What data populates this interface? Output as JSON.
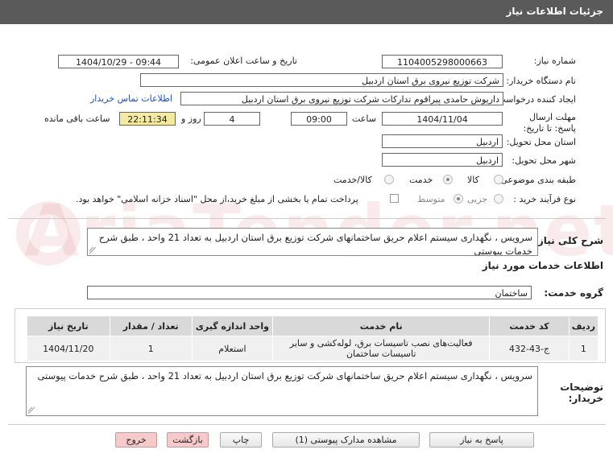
{
  "header": {
    "title": "جزئیات اطلاعات نیاز"
  },
  "form": {
    "need_number_label": "شماره نیاز:",
    "need_number": "1104005298000663",
    "announce_label": "تاریخ و ساعت اعلان عمومی:",
    "announce_value": "1404/10/29 - 09:44",
    "buyer_org_label": "نام دستگاه خریدار:",
    "buyer_org": "شرکت توزیع نیروی برق استان اردبیل",
    "requester_label": "ایجاد کننده درخواست:",
    "requester": "داریوش حامدی پیراقوم تدارکات شرکت توزیع نیروی برق استان اردبیل",
    "contact_link": "اطلاعات تماس خریدار",
    "deadline_label": "مهلت ارسال پاسخ: تا تاریخ:",
    "deadline_date": "1404/11/04",
    "time_label": "ساعت",
    "deadline_time": "09:00",
    "days_value": "4",
    "days_label": "روز و",
    "remaining_time": "22:11:34",
    "remaining_label": "ساعت باقی مانده",
    "province_label": "استان محل تحویل:",
    "province": "اردبیل",
    "city_label": "شهر محل تحویل:",
    "city": "اردبیل",
    "category_label": "طبقه بندی موضوعی:",
    "category_options": [
      "کالا",
      "خدمت",
      "کالا/خدمت"
    ],
    "category_selected": "خدمت",
    "purchase_type_label": "نوع فرآیند خرید :",
    "purchase_options": [
      "جزیی",
      "متوسط"
    ],
    "purchase_selected": "متوسط",
    "payment_note": "پرداخت تمام یا بخشی از مبلغ خرید،از محل \"اسناد خزانه اسلامی\" خواهد بود."
  },
  "summary": {
    "label": "شرح کلی نیاز:",
    "text": "سرویس ، نگهداری سیستم اعلام حریق ساختمانهای شرکت توزیع برق استان اردبیل به تعداد 21 واحد ، طبق شرح خدمات پیوستی"
  },
  "services": {
    "section_title": "اطلاعات خدمات مورد نیاز",
    "group_label": "گروه خدمت:",
    "group_value": "ساختمان",
    "columns": [
      "ردیف",
      "کد خدمت",
      "نام خدمت",
      "واحد اندازه گیری",
      "تعداد / مقدار",
      "تاریخ نیاز"
    ],
    "rows": [
      {
        "row": "1",
        "code": "ج-43-432",
        "name": "فعالیت‌های نصب تاسیسات برق، لوله‌کشی و سایر تاسیسات ساختمان",
        "unit": "استعلام",
        "qty": "1",
        "date": "1404/11/20"
      }
    ]
  },
  "buyer_notes": {
    "label": "توضیحات خریدار:",
    "text": "سرویس ، نگهداری سیستم اعلام حریق ساختمانهای شرکت توزیع برق استان اردبیل به تعداد 21 واحد ، طبق شرح خدمات پیوستی"
  },
  "buttons": {
    "respond": "پاسخ به نیاز",
    "view_docs": "مشاهده مدارک پیوستی (1)",
    "print": "چاپ",
    "back": "بازگشت",
    "exit": "خروج"
  },
  "watermark": "AriaTender.net",
  "colors": {
    "header_bg": "#5a5a5a",
    "remaining_bg": "#f4e9a3",
    "link": "#1a4fd0",
    "exit_bg": "#f6caca"
  }
}
